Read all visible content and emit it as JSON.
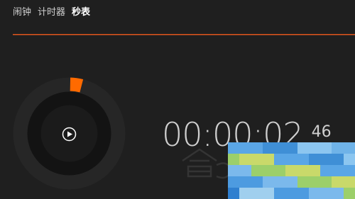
{
  "tabs": [
    {
      "label": "闹钟"
    },
    {
      "label": "计时器"
    },
    {
      "label": "秒表"
    }
  ],
  "active_tab": "秒表",
  "stopwatch": {
    "time_main": "00:00:02",
    "time_fraction": "46",
    "progress_fraction": 0.04,
    "play_icon": "play-icon"
  },
  "colors": {
    "background": "#1f1f1f",
    "accent": "#ff6a00",
    "text": "#cfcfcf",
    "dial_outer": "#2a2a2a",
    "dial_inner": "#141414",
    "divider": "#e0561c"
  }
}
